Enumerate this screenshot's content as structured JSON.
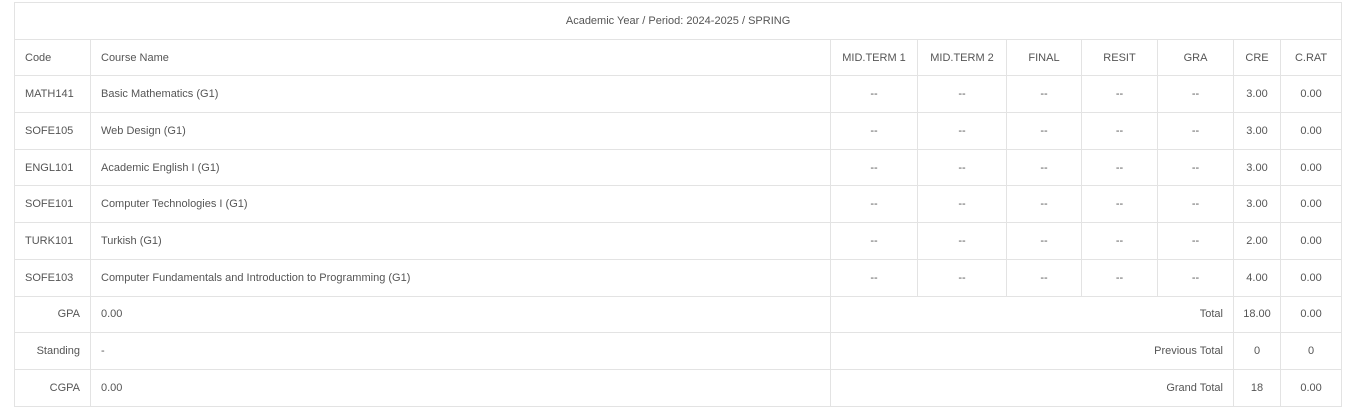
{
  "title": "Academic Year / Period: 2024-2025 / SPRING",
  "headers": {
    "code": "Code",
    "course_name": "Course Name",
    "midterm1": "MID.TERM 1",
    "midterm2": "MID.TERM 2",
    "final": "FINAL",
    "resit": "RESIT",
    "gra": "GRA",
    "cre": "CRE",
    "crat": "C.RAT"
  },
  "courses": [
    {
      "code": "MATH141",
      "name": "Basic Mathematics (G1)",
      "mt1": "--",
      "mt2": "--",
      "final": "--",
      "resit": "--",
      "gra": "--",
      "cre": "3.00",
      "crat": "0.00"
    },
    {
      "code": "SOFE105",
      "name": "Web Design (G1)",
      "mt1": "--",
      "mt2": "--",
      "final": "--",
      "resit": "--",
      "gra": "--",
      "cre": "3.00",
      "crat": "0.00"
    },
    {
      "code": "ENGL101",
      "name": "Academic English I (G1)",
      "mt1": "--",
      "mt2": "--",
      "final": "--",
      "resit": "--",
      "gra": "--",
      "cre": "3.00",
      "crat": "0.00"
    },
    {
      "code": "SOFE101",
      "name": "Computer Technologies I (G1)",
      "mt1": "--",
      "mt2": "--",
      "final": "--",
      "resit": "--",
      "gra": "--",
      "cre": "3.00",
      "crat": "0.00"
    },
    {
      "code": "TURK101",
      "name": "Turkish (G1)",
      "mt1": "--",
      "mt2": "--",
      "final": "--",
      "resit": "--",
      "gra": "--",
      "cre": "2.00",
      "crat": "0.00"
    },
    {
      "code": "SOFE103",
      "name": "Computer Fundamentals and Introduction to Programming (G1)",
      "mt1": "--",
      "mt2": "--",
      "final": "--",
      "resit": "--",
      "gra": "--",
      "cre": "4.00",
      "crat": "0.00"
    }
  ],
  "summary": [
    {
      "label": "GPA",
      "value": "0.00",
      "total_label": "Total",
      "cre": "18.00",
      "crat": "0.00"
    },
    {
      "label": "Standing",
      "value": "-",
      "total_label": "Previous Total",
      "cre": "0",
      "crat": "0"
    },
    {
      "label": "CGPA",
      "value": "0.00",
      "total_label": "Grand Total",
      "cre": "18",
      "crat": "0.00"
    }
  ]
}
